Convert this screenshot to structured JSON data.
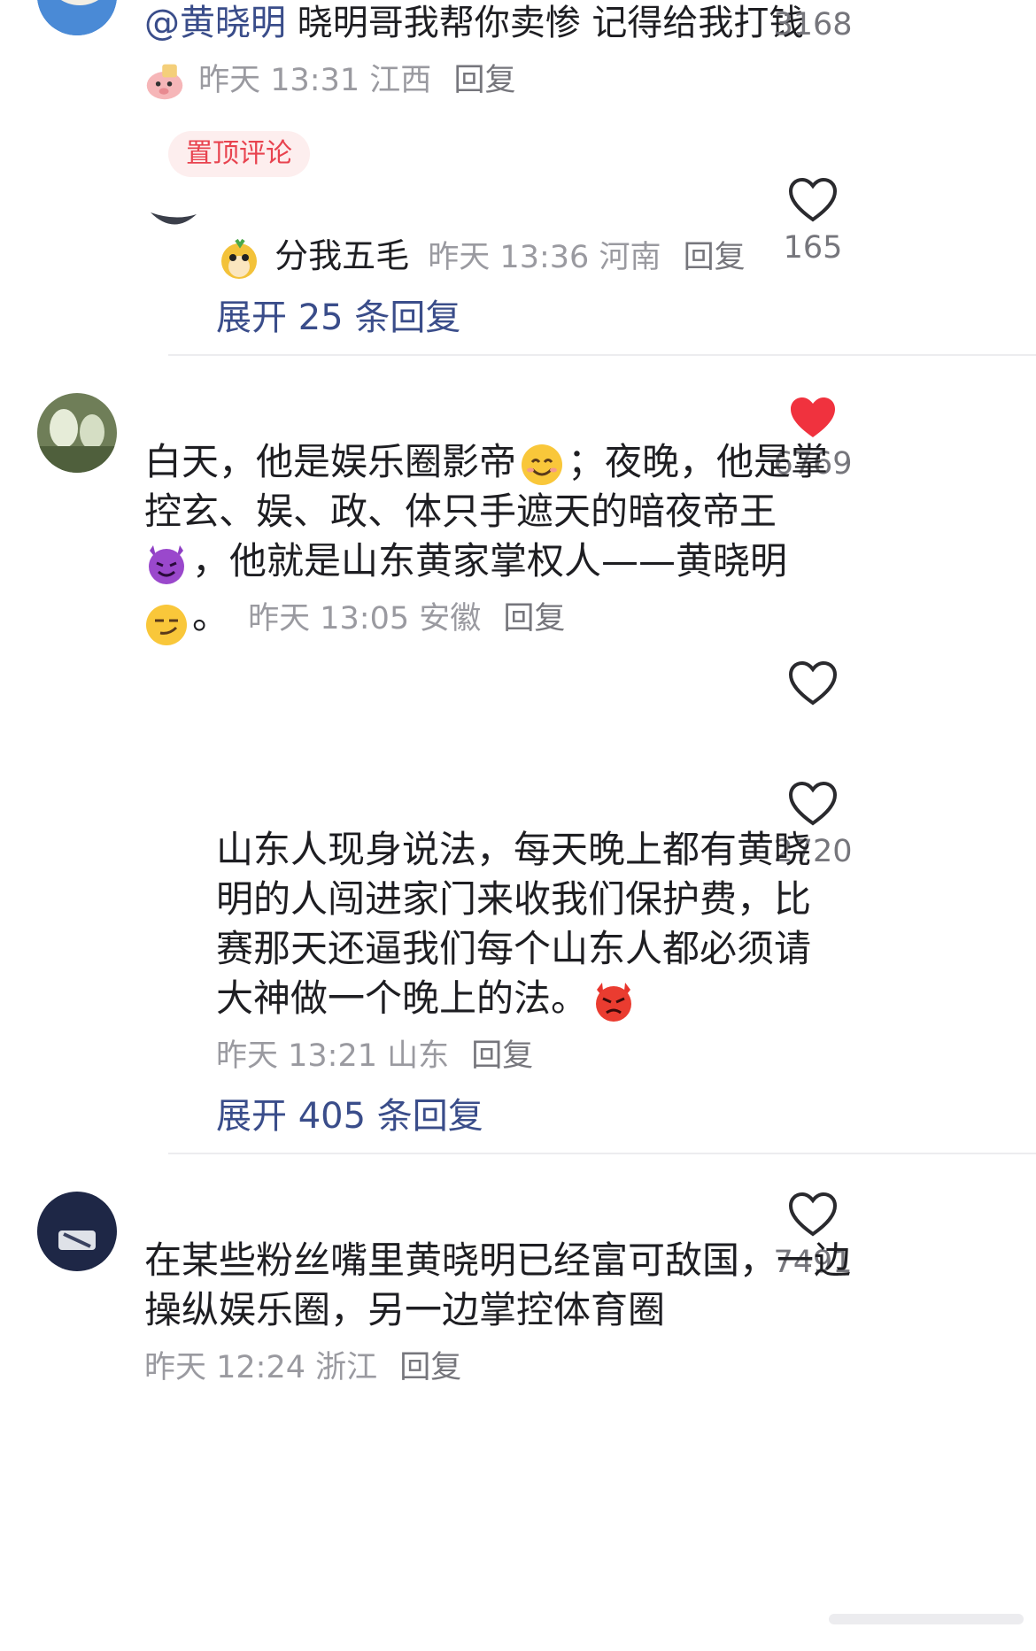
{
  "comments": [
    {
      "mention": "@黄晓明",
      "text": " 晓明哥我帮你卖惨 记得给我打钱",
      "time": "昨天 13:31",
      "location": "江西",
      "reply": "回复",
      "likes": "3168",
      "badge": "置顶评论",
      "sub_reply": {
        "username": "分我五毛",
        "time": "昨天 13:36",
        "location": "河南",
        "reply": "回复",
        "likes": "165",
        "expand": "展开 25 条回复"
      }
    },
    {
      "lines": [
        "白天，他是娱乐圈影帝",
        "；夜晚，他是掌",
        "控玄、娱、政、体只手遮天的暗夜帝王",
        "，他就是山东黄家掌权人——黄晓明",
        "。"
      ],
      "time": "昨天 13:05",
      "location": "安徽",
      "reply": "回复",
      "likes": "6769",
      "liked": true
    },
    {
      "lines": [
        "山东人现身说法，每天晚上都有黄晓",
        "明的人闯进家门来收我们保护费，比",
        "赛那天还逼我们每个山东人都必须请",
        "大神做一个晚上的法。"
      ],
      "time": "昨天 13:21",
      "location": "山东",
      "reply": "回复",
      "likes": "2720",
      "expand": "展开 405 条回复"
    },
    {
      "lines": [
        "在某些粉丝嘴里黄晓明已经富可敌国，一边",
        "操纵娱乐圈，另一边掌控体育圈"
      ],
      "time": "昨天 12:24",
      "location": "浙江",
      "reply": "回复",
      "likes": "7491"
    }
  ],
  "icons": {
    "heart_outline": "heart-outline-icon",
    "heart_filled": "heart-filled-icon",
    "smile": "smiling-face-emoji",
    "devil": "smiling-devil-emoji",
    "smirk": "smirking-face-emoji",
    "angry": "angry-face-emoji"
  },
  "colors": {
    "liked_heart": "#f0323e",
    "link_blue": "#3a4d8a",
    "badge_bg": "#fdeeee",
    "badge_text": "#e8434f"
  }
}
